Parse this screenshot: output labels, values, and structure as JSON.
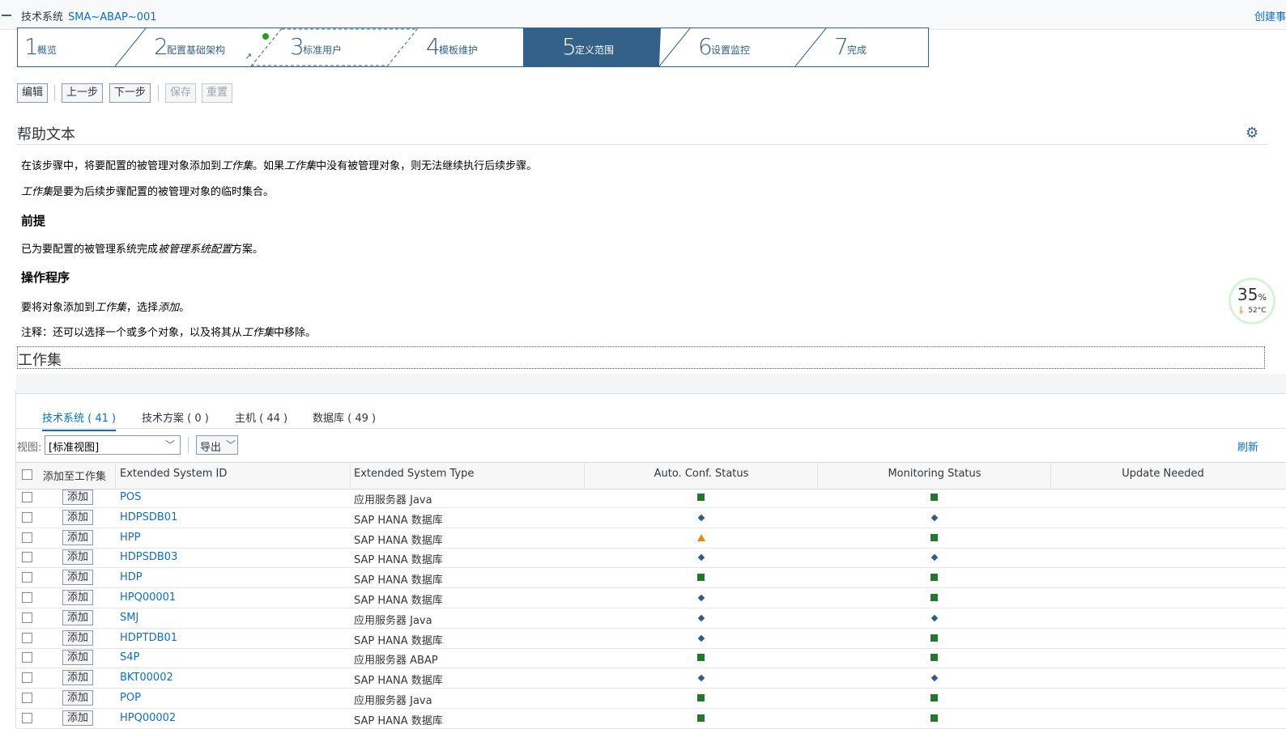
{
  "header": {
    "label": "技术系统",
    "value": "SMA~ABAP~001",
    "create_link": "创建事"
  },
  "roadmap": {
    "steps": [
      {
        "num": "1",
        "label": "概览",
        "active": false
      },
      {
        "num": "2",
        "label": "配置基础架构",
        "active": false
      },
      {
        "num": "3",
        "label": "标准用户",
        "active": false
      },
      {
        "num": "4",
        "label": "模板维护",
        "active": false
      },
      {
        "num": "5",
        "label": "定义范围",
        "active": true
      },
      {
        "num": "6",
        "label": "设置监控",
        "active": false
      },
      {
        "num": "7",
        "label": "完成",
        "active": false
      }
    ]
  },
  "toolbar": {
    "edit": "编辑",
    "prev": "上一步",
    "next": "下一步",
    "save": "保存",
    "reset": "重置"
  },
  "help": {
    "title": "帮助文本",
    "p1_a": "在该步骤中，将要配置的被管理对象添加到",
    "p1_b": "工作集",
    "p1_c": "。如果",
    "p1_d": "工作集",
    "p1_e": "中没有被管理对象，则无法继续执行后续步骤。",
    "p2_a": "工作集",
    "p2_b": "是要为后续步骤配置的被管理对象的临时集合。",
    "h_prereq": "前提",
    "p3_a": "已为要配置的被管理系统完成",
    "p3_b": "被管理系统配置",
    "p3_c": "方案。",
    "h_proc": "操作程序",
    "p4_a": "要将对象添加到",
    "p4_b": "工作集",
    "p4_c": "，选择",
    "p4_d": "添加",
    "p4_e": "。",
    "p5_a": "注释：还可以选择一个或多个对象，以及将其从",
    "p5_b": "工作集",
    "p5_c": "中移除。"
  },
  "widget": {
    "pct": "35",
    "pct_unit": "%",
    "temp": "52°C"
  },
  "workset": {
    "title": "工作集"
  },
  "tabs": [
    {
      "label": "技术系统 ( 41 )",
      "active": true
    },
    {
      "label": "技术方案 ( 0 )",
      "active": false
    },
    {
      "label": "主机 ( 44 )",
      "active": false
    },
    {
      "label": "数据库 ( 49 )",
      "active": false
    }
  ],
  "view": {
    "label": "视图:",
    "selected": "[标准视图]",
    "export": "导出",
    "refresh": "刷新"
  },
  "table": {
    "columns": [
      "添加至工作集",
      "Extended System ID",
      "Extended System Type",
      "Auto. Conf. Status",
      "Monitoring Status",
      "Update Needed"
    ],
    "add_label": "添加",
    "rows": [
      {
        "id": "POS",
        "type": "应用服务器 Java",
        "auto": "square",
        "mon": "square"
      },
      {
        "id": "HDPSDB01",
        "type": "SAP HANA 数据库",
        "auto": "diamond",
        "mon": "diamond"
      },
      {
        "id": "HPP",
        "type": "SAP HANA 数据库",
        "auto": "triangle",
        "mon": "square"
      },
      {
        "id": "HDPSDB03",
        "type": "SAP HANA 数据库",
        "auto": "diamond",
        "mon": "diamond"
      },
      {
        "id": "HDP",
        "type": "SAP HANA 数据库",
        "auto": "square",
        "mon": "square"
      },
      {
        "id": "HPQ00001",
        "type": "SAP HANA 数据库",
        "auto": "diamond",
        "mon": "square"
      },
      {
        "id": "SMJ",
        "type": "应用服务器 Java",
        "auto": "diamond",
        "mon": "diamond"
      },
      {
        "id": "HDPTDB01",
        "type": "SAP HANA 数据库",
        "auto": "diamond",
        "mon": "square"
      },
      {
        "id": "S4P",
        "type": "应用服务器 ABAP",
        "auto": "square",
        "mon": "square"
      },
      {
        "id": "BKT00002",
        "type": "SAP HANA 数据库",
        "auto": "diamond",
        "mon": "diamond"
      },
      {
        "id": "POP",
        "type": "应用服务器 Java",
        "auto": "square",
        "mon": "square"
      },
      {
        "id": "HPQ00002",
        "type": "SAP HANA 数据库",
        "auto": "square",
        "mon": "square"
      }
    ]
  },
  "colors": {
    "accent": "#346187",
    "link": "#0a6ed1",
    "ok": "#217a2a",
    "info": "#2c5d8a",
    "warn": "#e78c07"
  }
}
